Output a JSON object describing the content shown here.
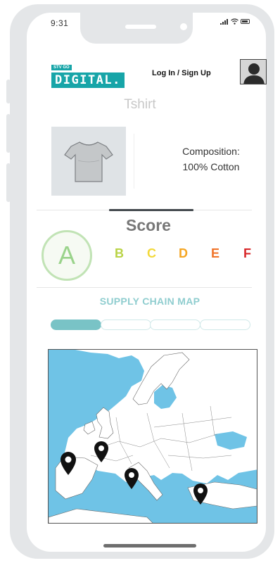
{
  "status_bar": {
    "time": "9:31",
    "signal_icon": "signal-icon",
    "wifi_icon": "wifi-icon",
    "battery_icon": "battery-icon"
  },
  "header": {
    "logo_small": "STV GO",
    "logo_main": "DIGITAL.",
    "login_label": "Log In / Sign Up",
    "avatar_icon": "user-silhouette-icon",
    "brand_color": "#17a5a8"
  },
  "product": {
    "name": "Tshirt",
    "image_icon": "tshirt-icon",
    "composition_label": "Composition:",
    "composition_value": "100% Cotton"
  },
  "score": {
    "title": "Score",
    "selected": "A",
    "grades": [
      {
        "label": "B",
        "color": "#b9d346"
      },
      {
        "label": "C",
        "color": "#f3d93b"
      },
      {
        "label": "D",
        "color": "#f5a623"
      },
      {
        "label": "E",
        "color": "#f0742a"
      },
      {
        "label": "F",
        "color": "#d8292b"
      }
    ]
  },
  "supply_chain": {
    "title": "SUPPLY CHAIN MAP",
    "steps_total": 4,
    "active_step": 1,
    "map_icon": "europe-map",
    "pins": [
      "map-pin-icon",
      "map-pin-icon",
      "map-pin-icon",
      "map-pin-icon"
    ]
  }
}
